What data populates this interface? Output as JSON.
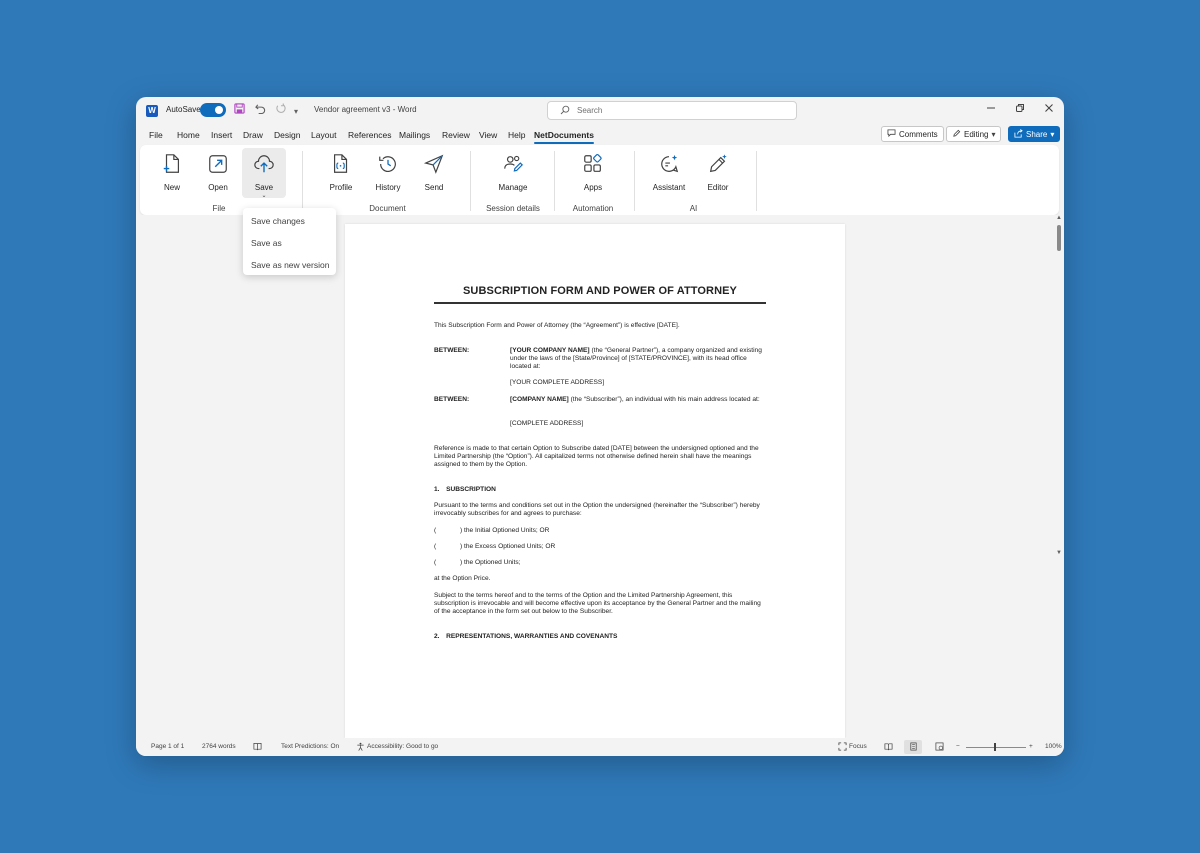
{
  "titlebar": {
    "autosave_label": "AutoSave",
    "doc_title": "Vendor agreement v3 - Word",
    "search_placeholder": "Search",
    "logo_letter": "W"
  },
  "menu": {
    "tabs": [
      "File",
      "Home",
      "Insert",
      "Draw",
      "Design",
      "Layout",
      "References",
      "Mailings",
      "Review",
      "View",
      "Help",
      "NetDocuments"
    ],
    "active_tab": "NetDocuments",
    "comments_label": "Comments",
    "editing_label": "Editing",
    "share_label": "Share"
  },
  "ribbon": {
    "groups": {
      "file": "File",
      "document": "Document",
      "session": "Session details",
      "automation": "Automation",
      "ai": "AI"
    },
    "buttons": {
      "new": "New",
      "open": "Open",
      "save": "Save",
      "profile": "Profile",
      "history": "History",
      "send": "Send",
      "manage": "Manage",
      "apps": "Apps",
      "assistant": "Assistant",
      "editor": "Editor"
    }
  },
  "save_menu": {
    "items": [
      "Save changes",
      "Save as",
      "Save as new version"
    ]
  },
  "document": {
    "title": "SUBSCRIPTION FORM AND POWER OF ATTORNEY",
    "intro": "This Subscription Form and Power of Attorney (the “Agreement”) is effective [DATE].",
    "between_label": "BETWEEN:",
    "party1_name": "[YOUR COMPANY NAME]",
    "party1_rest": " (the “General Partner”), a company organized and existing under the laws of the [State/Province] of [STATE/PROVINCE], with its head office located at:",
    "party1_address": "[YOUR COMPLETE ADDRESS]",
    "party2_name": "[COMPANY NAME]",
    "party2_rest": " (the “Subscriber”), an individual with his main address located at:",
    "party2_address": "[COMPLETE ADDRESS]",
    "reference": "Reference is made to that certain Option to Subscribe dated [DATE] between the undersigned optioned and the Limited Partnership (the “Option”). All capitalized terms not otherwise defined herein shall have the meanings assigned to them by the Option.",
    "section1": "1. SUBSCRIPTION",
    "section1_body": "Pursuant to the terms and conditions set out in the Option the undersigned (hereinafter the “Subscriber”) hereby irrevocably subscribes for and agrees to purchase:",
    "options": [
      "(   ) the Initial Optioned Units; OR",
      "(   ) the Excess Optioned Units; OR",
      "(   ) the Optioned Units;"
    ],
    "option_paren": "(",
    "option_texts": [
      ") the Initial Optioned Units; OR",
      ") the Excess Optioned Units; OR",
      ") the Optioned Units;"
    ],
    "price": "at the Option Price.",
    "subject": "Subject to the terms hereof and to the terms of the Option and the Limited Partnership Agreement, this subscription is irrevocable and will become effective upon its acceptance by the General Partner and the mailing of the acceptance in the form set out below to the Subscriber.",
    "section2": "2. REPRESENTATIONS, WARRANTIES AND COVENANTS"
  },
  "status": {
    "page": "Page 1 of 1",
    "words": "2764 words",
    "predictions": "Text Predictions: On",
    "accessibility": "Accessibility: Good to go",
    "focus": "Focus",
    "zoom_minus": "−",
    "zoom_plus": "+",
    "zoom": "100%",
    "zoom_level": 1.0
  },
  "colors": {
    "background": "#2f79b9",
    "accent": "#0f6cbd",
    "window": "#f3f3f3"
  }
}
